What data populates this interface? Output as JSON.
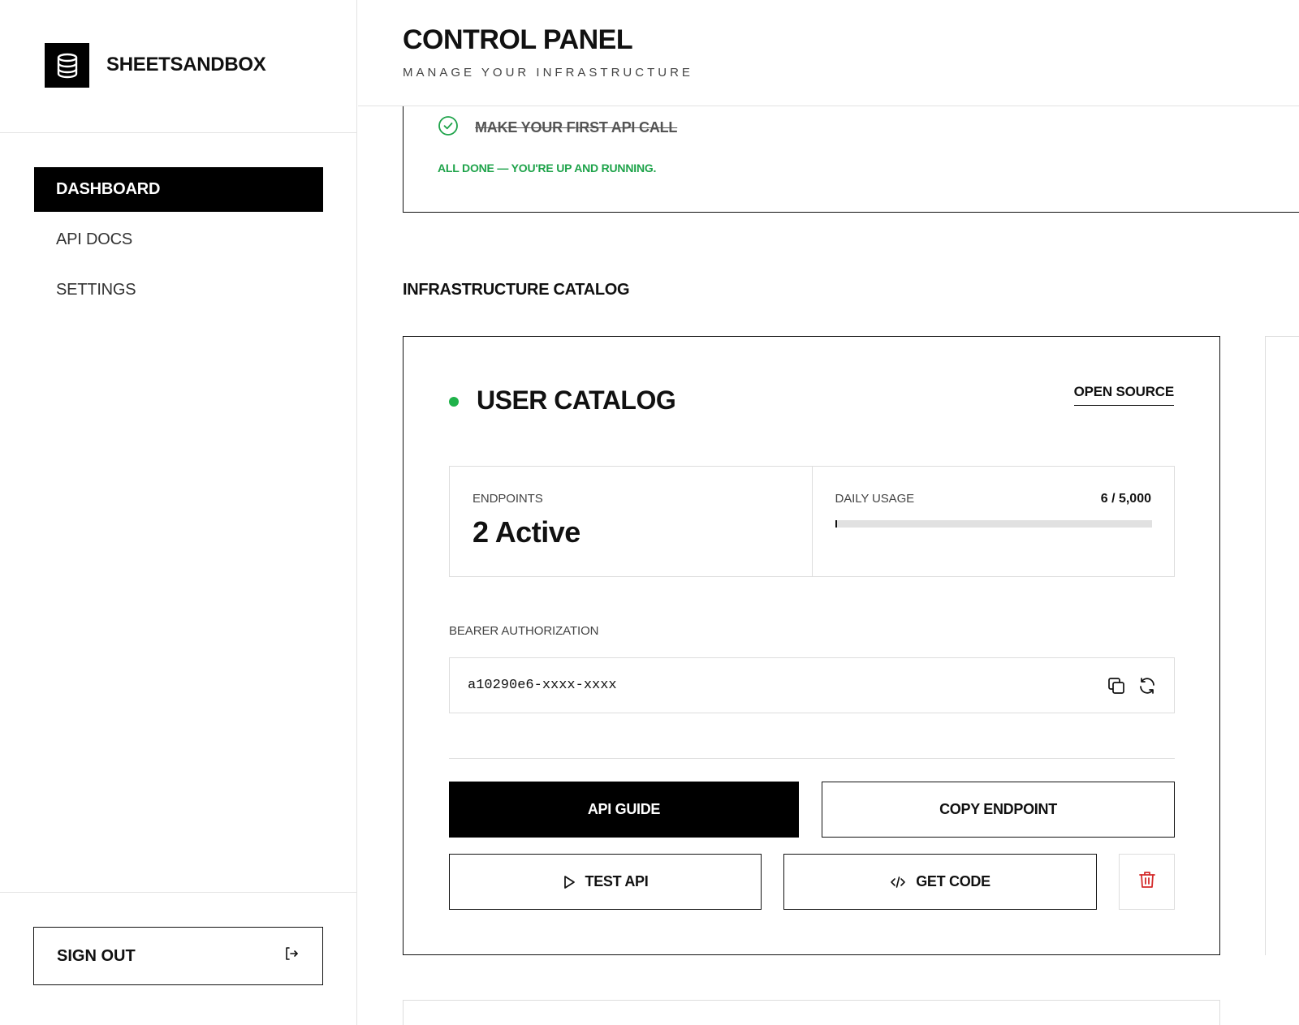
{
  "sidebar": {
    "brand_name": "SHEETSANDBOX",
    "brand_icon": "database-icon",
    "nav": [
      {
        "label": "DASHBOARD",
        "active": true
      },
      {
        "label": "API DOCS",
        "active": false
      },
      {
        "label": "SETTINGS",
        "active": false
      }
    ],
    "signout_label": "SIGN OUT",
    "signout_icon": "sign-out-icon"
  },
  "header": {
    "title": "CONTROL PANEL",
    "subtitle": "MANAGE YOUR INFRASTRUCTURE"
  },
  "setup": {
    "last_step": "MAKE YOUR FIRST API CALL",
    "last_step_done": true,
    "done_message": "ALL DONE — YOU'RE UP AND RUNNING."
  },
  "catalog": {
    "section_title": "INFRASTRUCTURE CATALOG",
    "card": {
      "status_color": "#1fb24a",
      "title": "USER CATALOG",
      "link_label": "OPEN SOURCE",
      "endpoints_label": "ENDPOINTS",
      "endpoints_value": "2 Active",
      "usage_label": "DAILY USAGE",
      "usage_text": "6 / 5,000",
      "usage_fraction": 0.0012,
      "auth_label": "BEARER AUTHORIZATION",
      "token": "a10290e6-xxxx-xxxx",
      "buttons": {
        "api_guide": "API GUIDE",
        "copy_endpoint": "COPY ENDPOINT",
        "test_api": "TEST API",
        "get_code": "GET CODE"
      }
    }
  },
  "colors": {
    "accent_green": "#1ea34a",
    "danger_red": "#d42a2a",
    "primary": "#000000"
  }
}
